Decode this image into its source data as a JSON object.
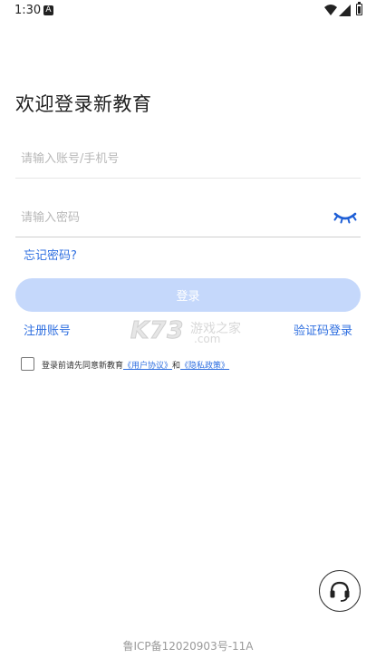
{
  "status_bar": {
    "time": "1:30",
    "app_icon": "A"
  },
  "page": {
    "title": "欢迎登录新教育"
  },
  "form": {
    "account_placeholder": "请输入账号/手机号",
    "password_placeholder": "请输入密码",
    "forgot_password": "忘记密码?",
    "login_label": "登录"
  },
  "links": {
    "register": "注册账号",
    "sms_login": "验证码登录"
  },
  "watermark": {
    "brand": "K73",
    "site": "游戏之家",
    "domain": ".com"
  },
  "agreement": {
    "prefix": "登录前请先同意新教育",
    "user_agreement": "《用户协议》",
    "and": "和",
    "privacy_policy": "《隐私政策》"
  },
  "footer": {
    "icp": "鲁ICP备12020903号-11A"
  },
  "icons": [
    "wifi-icon",
    "signal-icon",
    "battery-icon",
    "eye-closed-icon",
    "headset-icon"
  ],
  "colors": {
    "accent": "#2f6fe0",
    "button_disabled": "#c5d8fb"
  }
}
